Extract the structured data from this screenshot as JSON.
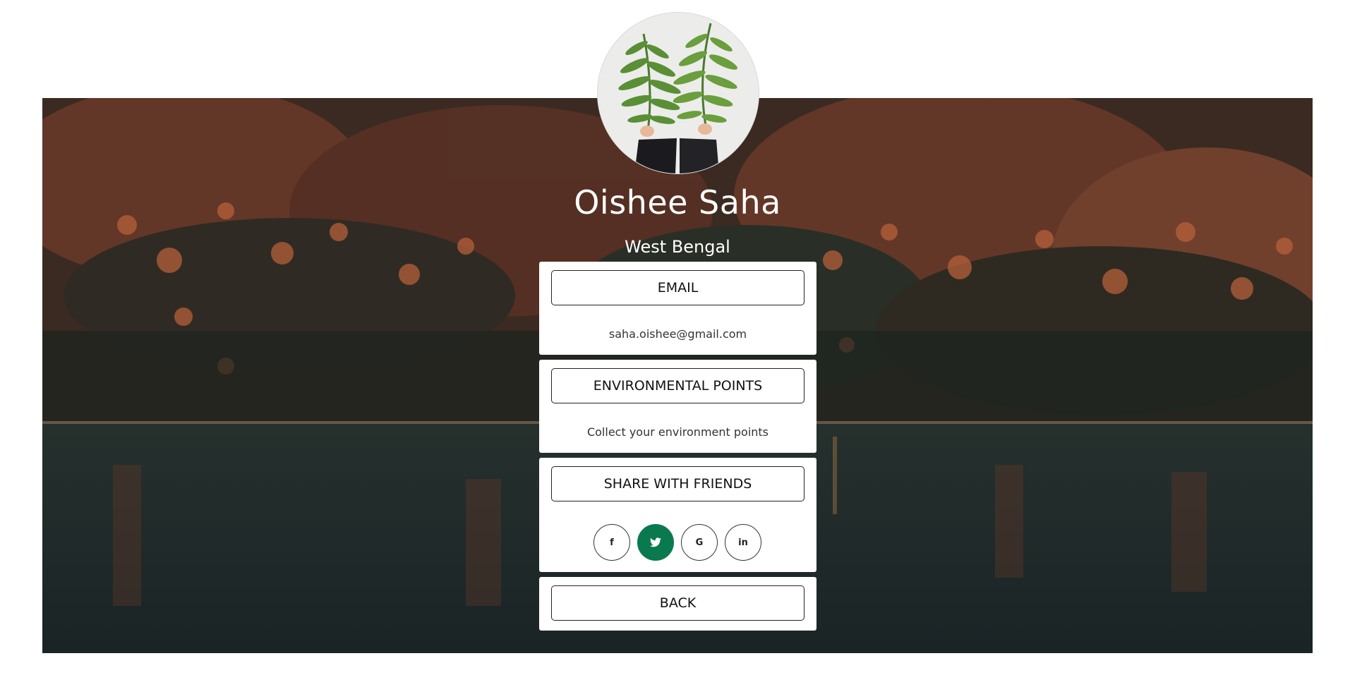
{
  "profile": {
    "name": "Oishee Saha",
    "location": "West Bengal"
  },
  "email_card": {
    "button_label": "EMAIL",
    "value": "saha.oishee@gmail.com"
  },
  "points_card": {
    "button_label": "ENVIRONMENTAL POINTS",
    "text": "Collect your environment points"
  },
  "share_card": {
    "button_label": "SHARE WITH FRIENDS",
    "socials": [
      {
        "label": "f",
        "icon": "facebook-icon"
      },
      {
        "label": "🐦",
        "icon": "twitter-icon",
        "active": true
      },
      {
        "label": "G",
        "icon": "google-icon"
      },
      {
        "label": "in",
        "icon": "linkedin-icon"
      }
    ]
  },
  "back_card": {
    "button_label": "BACK"
  },
  "colors": {
    "accent": "#0a7a4e",
    "card_bg": "#ffffff"
  }
}
